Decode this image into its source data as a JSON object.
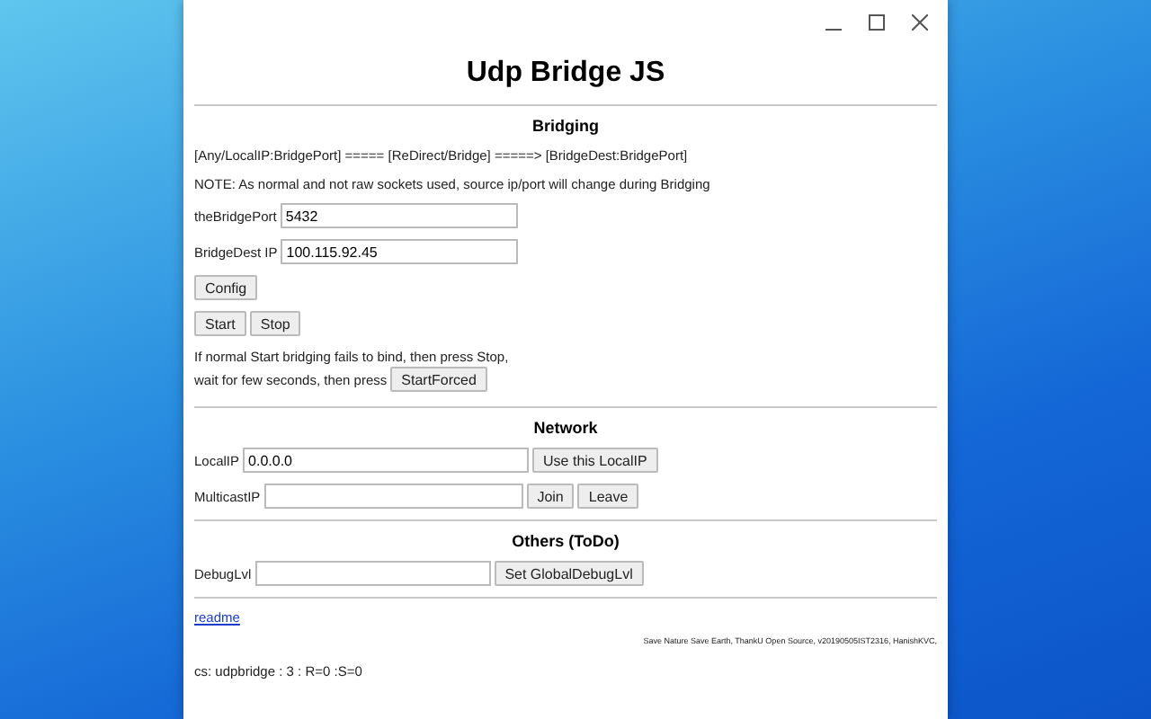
{
  "title": "Udp Bridge JS",
  "bridging": {
    "heading": "Bridging",
    "flow": "[Any/LocalIP:BridgePort] ===== [ReDirect/Bridge] =====> [BridgeDest:BridgePort]",
    "note": "NOTE: As normal and not raw sockets used, source ip/port will change during Bridging",
    "fields": [
      {
        "label": "theBridgePort",
        "value": "5432"
      },
      {
        "label": "BridgeDest IP",
        "value": "100.115.92.45"
      }
    ],
    "config_button": "Config",
    "start_button": "Start",
    "stop_button": "Stop",
    "hint_line1": "If normal Start bridging fails to bind, then press Stop,",
    "hint_line2": "wait for few seconds, then press",
    "forced_button": "StartForced"
  },
  "network": {
    "heading": "Network",
    "rows": [
      {
        "label": "LocalIP",
        "value": "0.0.0.0",
        "buttons": [
          "Use this LocalIP"
        ]
      },
      {
        "label": "MulticastIP",
        "buttons": [
          "Join",
          "Leave"
        ]
      }
    ]
  },
  "others": {
    "heading": "Others (ToDo)",
    "label": "DebugLvl",
    "button": "Set GlobalDebugLvl"
  },
  "link": "readme",
  "footer": "Save Nature Save Earth, ThankU Open Source, v20190505IST2316, HanishKVC,",
  "status": "cs: udpbridge : 3 : R=0 :S=0"
}
